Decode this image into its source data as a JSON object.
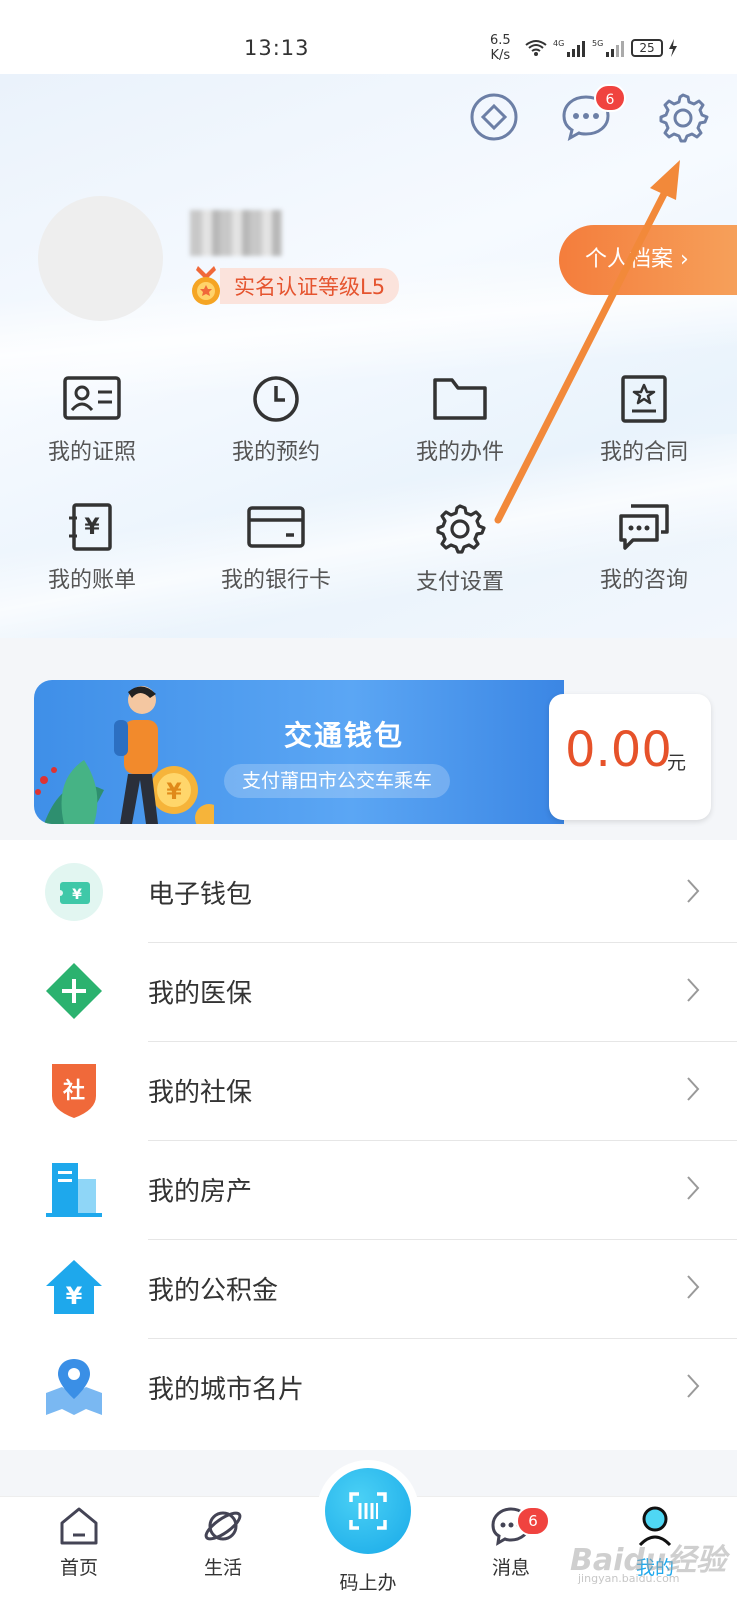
{
  "status_bar": {
    "time": "13:13",
    "speed": "6.5",
    "speed_unit": "K/s",
    "battery": "25"
  },
  "header": {
    "message_badge": "6"
  },
  "profile": {
    "certification": "实名认证等级L5",
    "archive_button": "个人档案 ›"
  },
  "grid": [
    {
      "label": "我的证照",
      "icon": "id-card-icon"
    },
    {
      "label": "我的预约",
      "icon": "clock-icon"
    },
    {
      "label": "我的办件",
      "icon": "folder-icon"
    },
    {
      "label": "我的合同",
      "icon": "contract-icon"
    },
    {
      "label": "我的账单",
      "icon": "bill-icon"
    },
    {
      "label": "我的银行卡",
      "icon": "bank-card-icon"
    },
    {
      "label": "支付设置",
      "icon": "gear-icon"
    },
    {
      "label": "我的咨询",
      "icon": "consult-icon"
    }
  ],
  "wallet": {
    "title": "交通钱包",
    "subtitle": "支付莆田市公交车乘车",
    "amount": "0.00",
    "unit": "元"
  },
  "list": [
    {
      "label": "电子钱包",
      "icon": "e-wallet-icon",
      "color": "#3fc8a8"
    },
    {
      "label": "我的医保",
      "icon": "medical-insurance-icon",
      "color": "#2bb26f"
    },
    {
      "label": "我的社保",
      "icon": "social-security-icon",
      "color": "#f0693a",
      "icon_text": "社"
    },
    {
      "label": "我的房产",
      "icon": "building-icon",
      "color": "#1ea8ec"
    },
    {
      "label": "我的公积金",
      "icon": "housing-fund-icon",
      "color": "#1ea8ec",
      "icon_text": "¥"
    },
    {
      "label": "我的城市名片",
      "icon": "city-card-icon",
      "color": "#3a8fe6"
    }
  ],
  "tabbar": {
    "tabs": [
      {
        "label": "首页",
        "icon": "home-icon"
      },
      {
        "label": "生活",
        "icon": "planet-icon"
      },
      {
        "label": "码上办",
        "icon": "scan-code-icon"
      },
      {
        "label": "消息",
        "icon": "chat-icon"
      },
      {
        "label": "我的",
        "icon": "profile-icon"
      }
    ],
    "message_badge": "6",
    "accent": "#1ea8ec"
  },
  "watermark": {
    "brand": "Baidu经验",
    "url": "jingyan.baidu.com"
  }
}
